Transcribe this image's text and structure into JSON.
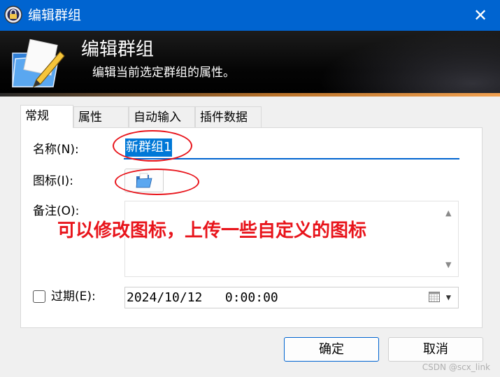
{
  "window": {
    "title": "编辑群组",
    "close_glyph": "✕"
  },
  "banner": {
    "title": "编辑群组",
    "subtitle": "编辑当前选定群组的属性。"
  },
  "tabs": [
    {
      "label": "常规",
      "active": true
    },
    {
      "label": "属性",
      "active": false
    },
    {
      "label": "自动输入",
      "active": false
    },
    {
      "label": "插件数据",
      "active": false
    }
  ],
  "form": {
    "name_label": "名称(N):",
    "name_value": "新群组1",
    "icon_label": "图标(I):",
    "notes_label": "备注(O):",
    "expires_label": "过期(E):",
    "expires_checked": false,
    "expires_value": "2024/10/12   0:00:00"
  },
  "annotation": {
    "text": "可以修改图标，上传一些自定义的图标",
    "color": "#e8141b"
  },
  "buttons": {
    "ok": "确定",
    "cancel": "取消"
  },
  "watermark": "CSDN @scx_link",
  "colors": {
    "titlebar": "#0064d0",
    "selection": "#0078d7",
    "annotation": "#e8141b"
  }
}
